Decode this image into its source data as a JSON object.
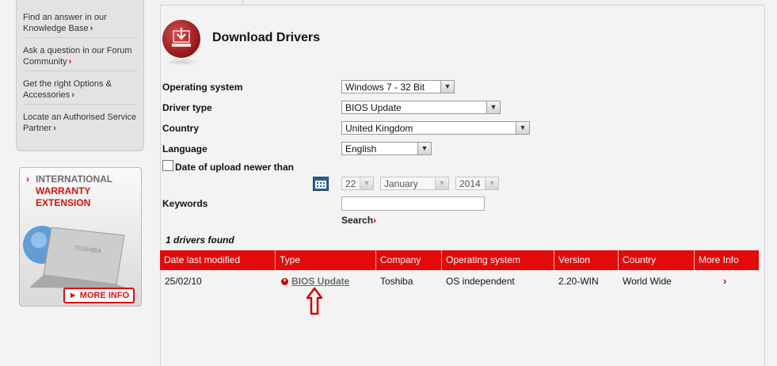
{
  "sidebar": {
    "links": [
      {
        "line1": "Find an answer in our",
        "line2": "Knowledge Base"
      },
      {
        "line1": "Ask a question in our Forum",
        "line2": "Community"
      },
      {
        "line1": "Get the right Options &",
        "line2": "Accessories"
      },
      {
        "line1": "Locate an Authorised Service",
        "line2": "Partner"
      }
    ],
    "arrow": "›"
  },
  "promo": {
    "line1": "INTERNATIONAL",
    "line2": "WARRANTY",
    "line3": "EXTENSION",
    "more_info": "► MORE INFO",
    "brand": "TOSHIBA"
  },
  "header": {
    "title": "Download Drivers"
  },
  "form": {
    "os_label": "Operating system",
    "os_value": "Windows 7 - 32 Bit",
    "driver_type_label": "Driver type",
    "driver_type_value": "BIOS Update",
    "country_label": "Country",
    "country_value": "United Kingdom",
    "language_label": "Language",
    "language_value": "English",
    "date_label": "Date of upload newer than",
    "date_day": "22",
    "date_month": "January",
    "date_year": "2014",
    "keywords_label": "Keywords",
    "keywords_value": "",
    "search_label": "Search"
  },
  "results": {
    "count_text": "1 drivers found",
    "columns": [
      "Date last modified",
      "Type",
      "Company",
      "Operating system",
      "Version",
      "Country",
      "More Info"
    ],
    "rows": [
      {
        "date": "25/02/10",
        "type": "BIOS Update",
        "company": "Toshiba",
        "os": "OS independent",
        "version": "2.20-WIN",
        "country": "World Wide"
      }
    ]
  },
  "colors": {
    "accent": "#e30a0a",
    "link_red": "#cc0000"
  },
  "icons": [
    "download-drivers-icon",
    "calendar-icon",
    "dropdown-arrow-icon",
    "red-chevron-icon",
    "annotation-up-arrow-icon"
  ]
}
